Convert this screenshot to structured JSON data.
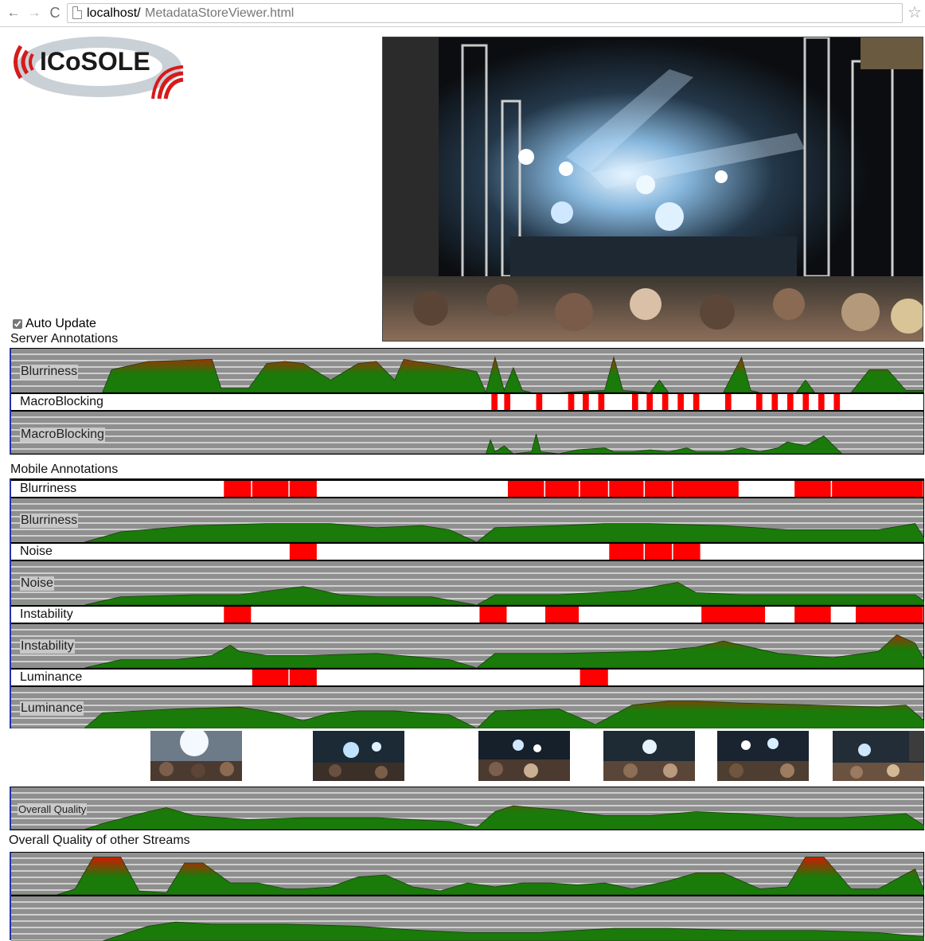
{
  "browser": {
    "url_host": "localhost/",
    "url_path": "MetadataStoreViewer.html"
  },
  "logo": {
    "text": "ICoSOLE"
  },
  "controls": {
    "auto_update_label": "Auto Update",
    "auto_update_checked": true
  },
  "colors": {
    "marker": "#ff0000",
    "fill_low": "#1a7a0a",
    "fill_high": "#e11000",
    "track_bg": "#8f8f8f",
    "grid_line": "#cfcfcf"
  },
  "server_annotations": {
    "title": "Server Annotations",
    "blurriness_label": "Blurriness",
    "macroblocking_marker_label": "MacroBlocking",
    "macroblocking_chart_label": "MacroBlocking"
  },
  "mobile_annotations": {
    "title": "Mobile Annotations",
    "blurriness_marker_label": "Blurriness",
    "blurriness_chart_label": "Blurriness",
    "noise_marker_label": "Noise",
    "noise_chart_label": "Noise",
    "instability_marker_label": "Instability",
    "instability_chart_label": "Instability",
    "luminance_marker_label": "Luminance",
    "luminance_chart_label": "Luminance"
  },
  "overall": {
    "chart_label": "Overall Quality"
  },
  "other_streams": {
    "title": "Overall Quality of other Streams"
  },
  "chart_data": [
    {
      "type": "area",
      "name": "server-blurriness",
      "x": [
        0,
        10,
        11,
        15,
        22,
        23,
        26,
        28,
        30,
        32,
        35,
        38,
        40,
        42,
        43,
        50,
        51,
        52,
        53,
        54,
        55,
        56,
        57,
        58,
        60,
        65,
        66,
        67,
        70,
        71,
        72,
        75,
        78,
        80,
        81,
        82,
        86,
        87,
        88,
        90,
        92,
        94,
        96,
        98,
        100
      ],
      "y": [
        0,
        0,
        0.55,
        0.75,
        0.8,
        0.1,
        0.1,
        0.7,
        0.75,
        0.7,
        0.3,
        0.7,
        0.75,
        0.3,
        0.8,
        0.55,
        0.5,
        0,
        0.85,
        0.05,
        0.6,
        0.05,
        0,
        0,
        0,
        0.05,
        0.85,
        0.05,
        0,
        0.3,
        0,
        0,
        0,
        0.85,
        0.05,
        0,
        0,
        0.3,
        0,
        0,
        0,
        0.55,
        0.55,
        0.05,
        0.05
      ]
    },
    {
      "type": "markers",
      "name": "server-macroblocking",
      "intervals": [
        [
          52.6,
          53.4
        ],
        [
          54.0,
          54.8
        ],
        [
          57.5,
          58.3
        ],
        [
          61.0,
          61.8
        ],
        [
          62.6,
          63.4
        ],
        [
          64.3,
          65.1
        ],
        [
          68.0,
          68.8
        ],
        [
          69.6,
          70.4
        ],
        [
          71.3,
          72.1
        ],
        [
          73.0,
          73.8
        ],
        [
          74.7,
          75.5
        ],
        [
          78.2,
          79.0
        ],
        [
          81.6,
          82.4
        ],
        [
          83.3,
          84.1
        ],
        [
          85.0,
          85.8
        ],
        [
          86.7,
          87.5
        ],
        [
          88.4,
          89.2
        ],
        [
          90.1,
          90.9
        ]
      ]
    },
    {
      "type": "area",
      "name": "server-macroblocking-chart",
      "x": [
        0,
        52,
        52.5,
        53,
        54,
        55,
        57,
        57.5,
        58,
        60,
        62,
        65,
        66,
        68,
        70,
        72,
        74,
        75,
        78,
        80,
        82,
        84,
        85,
        87,
        89,
        91,
        92,
        100
      ],
      "y": [
        0,
        0,
        0.35,
        0.05,
        0.2,
        0,
        0.05,
        0.5,
        0.05,
        0,
        0.1,
        0.15,
        0.05,
        0.05,
        0.1,
        0.05,
        0.15,
        0.05,
        0.05,
        0.15,
        0.05,
        0.15,
        0.3,
        0.2,
        0.45,
        0,
        0,
        0
      ]
    },
    {
      "type": "markers",
      "name": "mobile-blurriness-markers",
      "intervals": [
        [
          23.3,
          26.4
        ],
        [
          26.4,
          30.5
        ],
        [
          30.5,
          33.6
        ],
        [
          54.4,
          58.5
        ],
        [
          58.5,
          62.3
        ],
        [
          62.3,
          65.5
        ],
        [
          65.5,
          69.4
        ],
        [
          69.4,
          72.5
        ],
        [
          72.5,
          79.8
        ],
        [
          85.8,
          89.9
        ],
        [
          89.9,
          100
        ]
      ]
    },
    {
      "type": "area",
      "name": "mobile-blurriness",
      "x": [
        0,
        8,
        12,
        20,
        28,
        35,
        40,
        45,
        48,
        51,
        53,
        60,
        65,
        70,
        78,
        85,
        95,
        99,
        100
      ],
      "y": [
        0,
        0,
        0.25,
        0.4,
        0.45,
        0.45,
        0.35,
        0.4,
        0.3,
        0,
        0.35,
        0.4,
        0.45,
        0.45,
        0.4,
        0.3,
        0.3,
        0.45,
        0.1
      ]
    },
    {
      "type": "markers",
      "name": "mobile-noise-markers",
      "intervals": [
        [
          30.5,
          33.6
        ],
        [
          65.5,
          69.4
        ],
        [
          69.4,
          72.5
        ],
        [
          72.5,
          75.6
        ]
      ]
    },
    {
      "type": "area",
      "name": "mobile-noise",
      "x": [
        0,
        8,
        12,
        20,
        25,
        32,
        36,
        40,
        46,
        51,
        53,
        60,
        68,
        73,
        75,
        80,
        90,
        99,
        100
      ],
      "y": [
        0,
        0,
        0.2,
        0.25,
        0.25,
        0.45,
        0.25,
        0.2,
        0.2,
        0,
        0.25,
        0.25,
        0.35,
        0.55,
        0.3,
        0.25,
        0.25,
        0.25,
        0.1
      ]
    },
    {
      "type": "markers",
      "name": "mobile-instability-markers",
      "intervals": [
        [
          23.3,
          26.4
        ],
        [
          51.3,
          54.4
        ],
        [
          58.5,
          62.3
        ],
        [
          75.6,
          82.7
        ],
        [
          85.8,
          89.9
        ],
        [
          92.5,
          100
        ]
      ]
    },
    {
      "type": "area",
      "name": "mobile-instability",
      "x": [
        0,
        8,
        12,
        18,
        22,
        24,
        25,
        28,
        32,
        40,
        48,
        51,
        53,
        60,
        70,
        75,
        78,
        84,
        90,
        95,
        97,
        99,
        100
      ],
      "y": [
        0,
        0,
        0.2,
        0.2,
        0.3,
        0.55,
        0.4,
        0.3,
        0.3,
        0.35,
        0.2,
        0,
        0.35,
        0.35,
        0.4,
        0.5,
        0.65,
        0.35,
        0.25,
        0.4,
        0.8,
        0.6,
        0.2
      ]
    },
    {
      "type": "markers",
      "name": "mobile-luminance-markers",
      "intervals": [
        [
          26.4,
          30.5
        ],
        [
          30.5,
          33.6
        ],
        [
          62.3,
          65.5
        ]
      ]
    },
    {
      "type": "area",
      "name": "mobile-luminance",
      "x": [
        0,
        8,
        10,
        18,
        25,
        29,
        32,
        35,
        38,
        42,
        48,
        51,
        53,
        60,
        64,
        68,
        72,
        75,
        80,
        88,
        95,
        98,
        100
      ],
      "y": [
        0,
        0,
        0.4,
        0.5,
        0.55,
        0.4,
        0.2,
        0.4,
        0.45,
        0.45,
        0.35,
        0,
        0.45,
        0.5,
        0.1,
        0.6,
        0.7,
        0.7,
        0.65,
        0.6,
        0.55,
        0.6,
        0.2
      ]
    },
    {
      "type": "area",
      "name": "overall-quality",
      "x": [
        0,
        8,
        10,
        15,
        17,
        20,
        26,
        32,
        40,
        48,
        51,
        53,
        55,
        57,
        60,
        65,
        70,
        75,
        80,
        86,
        91,
        95,
        98,
        100
      ],
      "y": [
        0,
        0,
        0.15,
        0.45,
        0.55,
        0.35,
        0.25,
        0.3,
        0.3,
        0.2,
        0.05,
        0.45,
        0.6,
        0.55,
        0.5,
        0.35,
        0.35,
        0.45,
        0.4,
        0.3,
        0.3,
        0.35,
        0.4,
        0.1
      ]
    },
    {
      "type": "area",
      "name": "other-stream-1",
      "x": [
        0,
        5,
        7,
        9,
        12,
        14,
        17,
        19,
        21,
        24,
        27,
        30,
        32,
        35,
        38,
        41,
        44,
        47,
        50,
        53,
        56,
        59,
        62,
        65,
        68,
        72,
        75,
        78,
        82,
        85,
        87,
        89,
        92,
        95,
        97,
        99,
        100
      ],
      "y": [
        0,
        0,
        0.15,
        0.95,
        0.95,
        0.1,
        0.05,
        0.8,
        0.8,
        0.3,
        0.3,
        0.15,
        0.15,
        0.2,
        0.45,
        0.5,
        0.2,
        0.1,
        0.3,
        0.2,
        0.3,
        0.3,
        0.25,
        0.3,
        0.15,
        0.35,
        0.55,
        0.55,
        0.15,
        0.2,
        0.95,
        0.95,
        0.15,
        0.15,
        0.4,
        0.65,
        0.1
      ]
    },
    {
      "type": "area",
      "name": "other-stream-2",
      "x": [
        0,
        10,
        15,
        18,
        22,
        30,
        38,
        45,
        50,
        58,
        66,
        72,
        80,
        88,
        95,
        100
      ],
      "y": [
        0,
        0,
        0.35,
        0.45,
        0.4,
        0.4,
        0.35,
        0.25,
        0.2,
        0.2,
        0.3,
        0.3,
        0.25,
        0.25,
        0.2,
        0.1
      ]
    }
  ]
}
